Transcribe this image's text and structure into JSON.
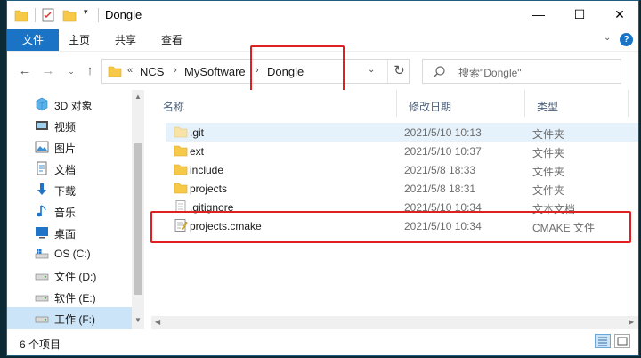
{
  "window": {
    "title": "Dongle"
  },
  "titlebar": {
    "minimize": "—",
    "maximize": "☐",
    "close": "✕"
  },
  "ribbon": {
    "tabs": [
      "文件",
      "主页",
      "共享",
      "查看"
    ],
    "expand": "⌄",
    "help": "?"
  },
  "nav": {
    "back": "←",
    "forward": "→",
    "recent": "⌄",
    "up": "↑",
    "overflow": "«",
    "breadcrumbs": [
      "NCS",
      "MySoftware",
      "Dongle"
    ],
    "dropdown": "⌄",
    "refresh": "↻",
    "search_placeholder": "搜索\"Dongle\""
  },
  "sidebar": {
    "items": [
      {
        "label": "3D 对象",
        "icon": "3d-objects-icon"
      },
      {
        "label": "视频",
        "icon": "video-icon"
      },
      {
        "label": "图片",
        "icon": "pictures-icon"
      },
      {
        "label": "文档",
        "icon": "documents-icon"
      },
      {
        "label": "下载",
        "icon": "downloads-icon"
      },
      {
        "label": "音乐",
        "icon": "music-icon"
      },
      {
        "label": "桌面",
        "icon": "desktop-icon"
      },
      {
        "label": "OS (C:)",
        "icon": "os-drive-icon"
      },
      {
        "label": "文件 (D:)",
        "icon": "drive-icon"
      },
      {
        "label": "软件 (E:)",
        "icon": "drive-icon"
      },
      {
        "label": "工作 (F:)",
        "icon": "drive-icon"
      }
    ],
    "selected_index": 10
  },
  "columns": {
    "name": "名称",
    "date": "修改日期",
    "type": "类型"
  },
  "files": [
    {
      "name": ".git",
      "date": "2021/5/10 10:13",
      "type": "文件夹",
      "icon": "hidden-folder-icon"
    },
    {
      "name": "ext",
      "date": "2021/5/10 10:37",
      "type": "文件夹",
      "icon": "folder-icon"
    },
    {
      "name": "include",
      "date": "2021/5/8 18:33",
      "type": "文件夹",
      "icon": "folder-icon"
    },
    {
      "name": "projects",
      "date": "2021/5/8 18:31",
      "type": "文件夹",
      "icon": "folder-icon"
    },
    {
      "name": ".gitignore",
      "date": "2021/5/10 10:34",
      "type": "文本文档",
      "icon": "text-file-icon"
    },
    {
      "name": "projects.cmake",
      "date": "2021/5/10 10:34",
      "type": "CMAKE 文件",
      "icon": "cmake-file-icon"
    }
  ],
  "status": {
    "item_count": "6 个项目"
  },
  "colors": {
    "accent": "#1a73c5",
    "selection": "#cce4f7",
    "folder": "#f7c948",
    "highlight_box": "#e02020"
  }
}
